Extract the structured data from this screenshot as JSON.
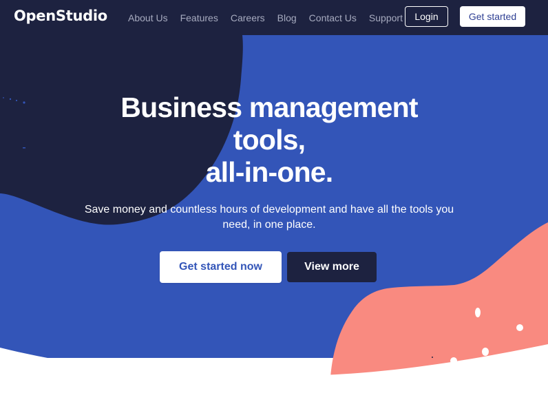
{
  "brand": {
    "name": "OpenStudio"
  },
  "nav": {
    "links": [
      "About Us",
      "Features",
      "Careers",
      "Blog",
      "Contact Us",
      "Support"
    ],
    "login_label": "Login",
    "get_started_label": "Get started"
  },
  "hero": {
    "headline_line1": "Business management",
    "headline_line2": "tools,",
    "headline_line3": "all-in-one.",
    "subtext": "Save money and countless hours of development and have all the tools you need, in one place.",
    "primary_cta": "Get started now",
    "secondary_cta": "View more"
  },
  "colors": {
    "navy": "#1d2240",
    "blue": "#3355b8",
    "coral": "#f98a80",
    "white": "#ffffff",
    "nav_text": "#a7abbf"
  }
}
